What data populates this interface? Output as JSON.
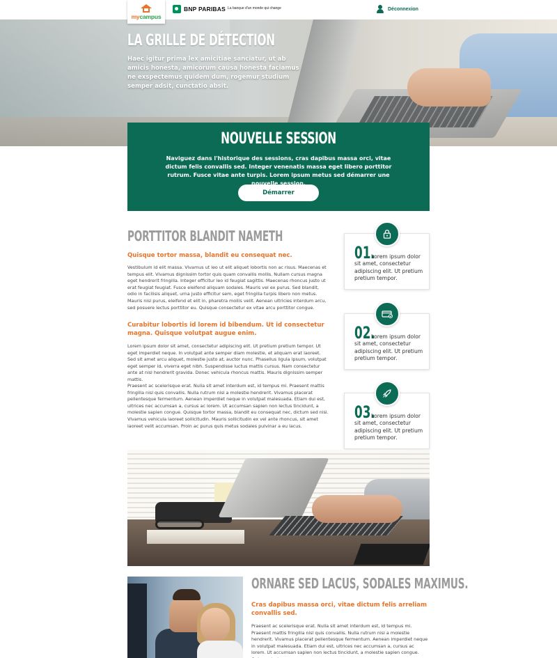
{
  "nav": {
    "logo_main": "my",
    "logo_accent": "campus",
    "bank_name": "BNP PARIBAS",
    "bank_tagline": "La banque d'un monde qui change",
    "logout_label": "Déconnexion"
  },
  "hero": {
    "title": "LA GRILLE DE DÉTECTION",
    "text": "Haec igitur prima lex amicitiae sanciatur, ut ab amicis honesta, amicorum causa honesta faciamus ne exspectemus quidem dum, rogemur studium semper adsit, cunctatio absit."
  },
  "session": {
    "title": "NOUVELLE SESSION",
    "text": "Naviguez dans l'historique des sessions, cras dapibus massa orci, vitae dictum felis convallis sed. Integer venenatis massa eget libero porttitor rutrum. Fusce vitae ante turpis. Lorem ipsum metus sed démarrer une nouvelle session.",
    "button_label": "Démarrer"
  },
  "article": {
    "title": "PORTTITOR BLANDIT NAMETH",
    "lead1": "Quisque tortor massa, blandit eu consequat nec.",
    "para1": "Vestibulum id elit massa. Vivamus ut leo ut elit aliquet lobortis non ac risus. Maecenas et tempus elit. Vivamus dignissim tortor quis quam convallis mollis. Nullam cursus magna eget hendrerit fringilla. Integer efficitur leo id feugiat sagittis. Maecenas rhoncus justo ut erat feugiat feugiat. Fusce eleifend aliquam sodales. Mauris vel ex purus. Sed blandit, odio in facilisis aliquet, urna justo efficitur sem, eget fringilla turpis libero non metus. Mauris nisi purus, eleifend et elit in, pharetra mollis velit. Aenean ultricies interdum arcu, sed posuere lectus porttitor eu. Quisque consectetur ex vitae arcu porttitor congue.",
    "lead2": "Curabitur lobortis id lorem id bibendum. Ut id consectetur magna. Quisque volutpat augue enim.",
    "para2": "Lorem ipsum dolor sit amet, consectetur adipiscing elit. Ut pretium pretium tempor. Ut eget imperdiet neque. In volutpat ante semper diam molestie, et aliquam erat laoreet. Sed sit amet arcu aliquet, molestie justo at, auctor nunc. Phasellus ligula ipsum, volutpat eget semper id, viverra eget nibh. Suspendisse luctus mattis cursus. Nam consectetur ante at nisl hendrerit gravida. Donec vehicula rhoncus mattis. Mauris dignissim semper mattis.",
    "para3": "Praesent ac scelerisque erat. Nulla sit amet interdum est, id tempus mi. Praesent mattis fringilla nisl quis convallis. Nulla rutrum nisi a molestie hendrerit. Vivamus placerat pellentesque fermentum. Aenean imperdiet neque in volutpat malesuada. Etiam dui est, ultrices nec accumsan a, cursus ac lorem. Ut accumsan sapien non lectus tincidunt, a molestie sapien congue. Quisque tortor massa, blandit eu consequat nec, dictum sed nisi. Vivamus vehicula laoreet sollicitudin. Mauris sollicitudin ex vel ante rhoncus, sit amet laoreet velit accumsan. Proin ac purus quis metus sodales pulvinar a eu lacus."
  },
  "steps": [
    {
      "number": "01.",
      "icon": "lock-icon",
      "text": "Lorem ipsum dolor sit amet, consectetur adipiscing elit. Ut pretium pretium tempor."
    },
    {
      "number": "02.",
      "icon": "credit-card-icon",
      "text": "Lorem ipsum dolor sit amet, consectetur adipiscing elit. Ut pretium pretium tempor."
    },
    {
      "number": "03.",
      "icon": "rocket-icon",
      "text": "Lorem ipsum dolor sit amet, consectetur adipiscing elit. Ut pretium pretium tempor."
    }
  ],
  "section2": {
    "title": "ORNARE SED LACUS, SODALES MAXIMUS.",
    "lead": "Cras dapibus massa orci, vitae dictum felis arreliam convallis sed.",
    "para": "Praesent ac scelerisque erat. Nulla sit amet interdum est, id tempus mi. Praesent mattis fringilla nisl quis convallis. Nulla rutrum nisi a molestie hendrerit. Vivamus placerat pellentesque fermentum. Aenean imperdiet neque in volutpat malesuada. Etiam dui est, ultrices nec accumsan a, cursus ac lorem. Ut accumsan sapien non lectus tincidunt, a molestie sapien congue. Quisque tortor massa,"
  },
  "colors": {
    "brand_green": "#0b6b54",
    "accent_orange": "#e8742a",
    "title_gray": "#9b9b9b"
  }
}
